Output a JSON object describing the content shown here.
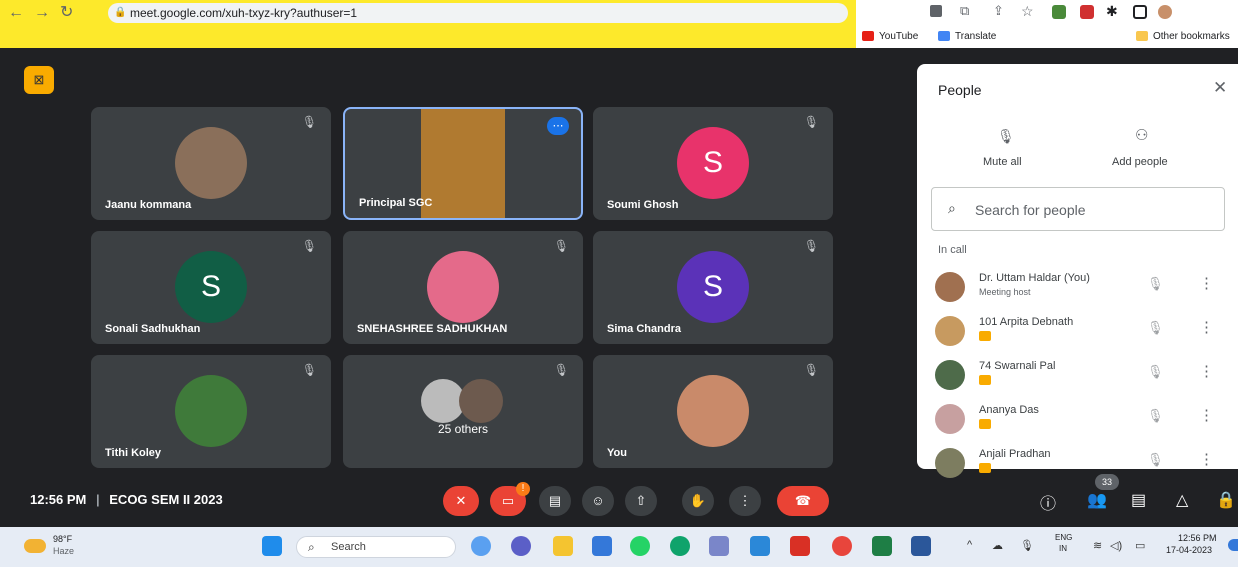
{
  "browser": {
    "url": "meet.google.com/xuh-txyz-kry?authuser=1",
    "bookmarks": [
      "YouTube",
      "Translate",
      "Other bookmarks"
    ]
  },
  "meet": {
    "tiles": [
      {
        "name": "Jaanu kommana",
        "type": "photo",
        "color": "#8a6f5a"
      },
      {
        "name": "Principal SGC",
        "type": "video",
        "color": "#b07a30"
      },
      {
        "name": "Soumi Ghosh",
        "type": "letter",
        "letter": "S",
        "color": "#e8336b"
      },
      {
        "name": "Sonali Sadhukhan",
        "type": "letter",
        "letter": "S",
        "color": "#115e45"
      },
      {
        "name": "SNEHASHREE SADHUKHAN",
        "type": "photo",
        "color": "#e46a8a"
      },
      {
        "name": "Sima Chandra",
        "type": "letter",
        "letter": "S",
        "color": "#5b32b8"
      },
      {
        "name": "Tithi Koley",
        "type": "photo",
        "color": "#3f7a3a"
      },
      {
        "name": "25 others",
        "type": "others",
        "color": "#777"
      },
      {
        "name": "You",
        "type": "photo",
        "color": "#c98a6a"
      }
    ],
    "time": "12:56 PM",
    "separator": "|",
    "meeting_name": "ECOG SEM II 2023",
    "participant_count": "33"
  },
  "people_panel": {
    "title": "People",
    "mute_all": "Mute all",
    "add_people": "Add people",
    "search_placeholder": "Search for people",
    "section": "In call",
    "participants": [
      {
        "name": "Dr. Uttam Haldar (You)",
        "sub": "Meeting host",
        "color": "#a07050"
      },
      {
        "name": "101 Arpita Debnath",
        "sub": "",
        "color": "#c79a60"
      },
      {
        "name": "74 Swarnali Pal",
        "sub": "",
        "color": "#4e6b4a"
      },
      {
        "name": "Ananya Das",
        "sub": "",
        "color": "#c7a0a0"
      },
      {
        "name": "Anjali Pradhan",
        "sub": "",
        "color": "#7d7d60"
      }
    ]
  },
  "taskbar": {
    "weather_temp": "98°F",
    "weather_desc": "Haze",
    "search": "Search",
    "lang1": "ENG",
    "lang2": "IN",
    "clock_time": "12:56 PM",
    "clock_date": "17-04-2023"
  }
}
